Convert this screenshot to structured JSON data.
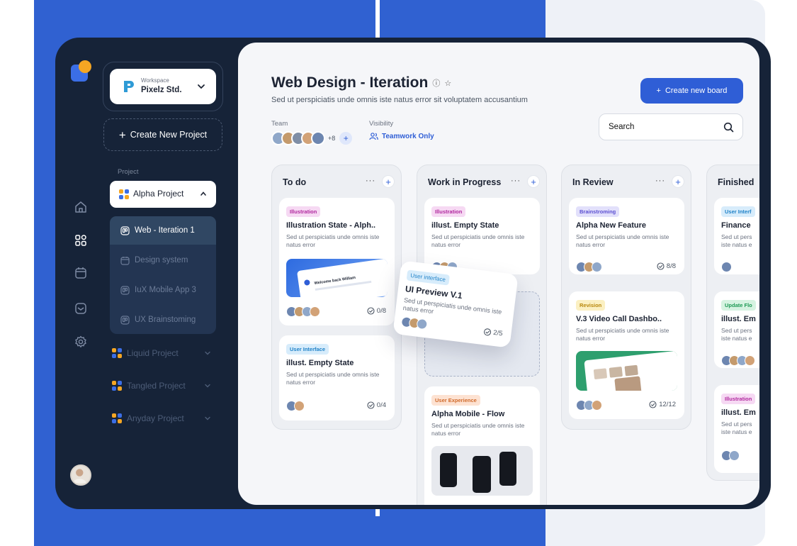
{
  "workspace": {
    "small_label": "Workspace",
    "name": "Pixelz Std."
  },
  "sidebar": {
    "create_project": "Create New Project",
    "project_label": "Project",
    "active_project": "Alpha Project",
    "sub_items": [
      "Web - Iteration 1",
      "Design system",
      "IuX Mobile App 3",
      "UX Brainstoming"
    ],
    "projects": [
      "Liquid Project",
      "Tangled Project",
      "Anyday Project"
    ]
  },
  "rail_icons": [
    "home-icon",
    "grid-icon",
    "calendar-icon",
    "inbox-icon",
    "settings-icon"
  ],
  "header": {
    "title": "Web Design - Iteration",
    "subtitle": "Sed ut perspiciatis unde omnis iste natus error sit voluptatem accusantium",
    "create_board": "Create new board",
    "team_label": "Team",
    "team_more": "+8",
    "visibility_label": "Visibility",
    "visibility_value": "Teamwork Only",
    "search_placeholder": "Search"
  },
  "columns": [
    {
      "name": "To do",
      "cards": [
        {
          "tag": "Illustration",
          "title": "Illustration State - Alph..",
          "desc": "Sed ut perspiciatis unde omnis iste natus error",
          "count": "0/8"
        },
        {
          "tag": "User Interface",
          "title": "illust. Empty State",
          "desc": "Sed ut perspiciatis unde omnis iste natus error",
          "count": "0/4"
        }
      ]
    },
    {
      "name": "Work in Progress",
      "cards": [
        {
          "tag": "Illustration",
          "title": "illust. Empty State",
          "desc": "Sed ut perspiciatis unde omnis iste natus error"
        },
        {
          "tag": "User Experience",
          "title": "Alpha Mobile - Flow",
          "desc": "Sed ut perspiciatis unde omnis iste natus error"
        }
      ]
    },
    {
      "name": "In Review",
      "cards": [
        {
          "tag": "Brainstroming",
          "title": "Alpha New Feature",
          "desc": "Sed ut perspiciatis unde omnis iste natus error",
          "count": "8/8"
        },
        {
          "tag": "Revision",
          "title": "V.3 Video Call Dashbo..",
          "desc": "Sed ut perspiciatis unde omnis iste natus error",
          "count": "12/12"
        }
      ]
    },
    {
      "name": "Finished",
      "cards": [
        {
          "tag": "User Interf",
          "title": "Finance",
          "desc": "Sed ut pers iste natus e"
        },
        {
          "tag": "Update Flo",
          "title": "illust. Em",
          "desc": "Sed ut pers iste natus e"
        },
        {
          "tag": "Illustration",
          "title": "illust. Em",
          "desc": "Sed ut pers iste natus e"
        }
      ]
    }
  ],
  "floating_card": {
    "tag": "User interface",
    "title": "UI Preview V.1",
    "desc": "Sed ut perspiciatis unde omnis iste natus error",
    "count": "2/5"
  },
  "thumb_text": {
    "welcome": "Welcome back William"
  },
  "colors": {
    "accent": "#2f5ed6",
    "sidebar": "#162338",
    "backdrop_blue": "#3061d1"
  }
}
